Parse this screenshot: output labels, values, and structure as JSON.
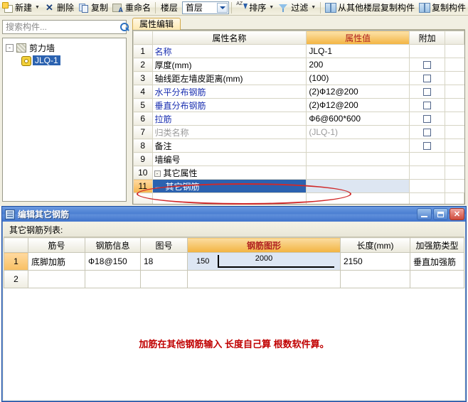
{
  "toolbar": {
    "items": [
      {
        "label": "新建",
        "icon": "new-icon",
        "caret": true
      },
      {
        "label": "删除",
        "icon": "delete-icon",
        "caret": false
      },
      {
        "label": "复制",
        "icon": "copy-icon",
        "caret": false
      },
      {
        "label": "重命名",
        "icon": "rename-icon",
        "caret": false
      }
    ],
    "floor_label": "楼层",
    "floor_value": "首层",
    "sort_label": "排序",
    "filter_label": "过滤",
    "copy_from_other_floor_label": "从其他楼层复制构件",
    "copy_component_label": "复制构件"
  },
  "sidebar": {
    "search": {
      "placeholder": "搜索构件...",
      "value": "",
      "icon": "search-icon"
    },
    "tree": {
      "root": {
        "label": "剪力墙",
        "icon": "shear-wall-icon",
        "expander": "-"
      },
      "child": {
        "label": "JLQ-1",
        "icon": "component-gear-icon",
        "selected": true
      }
    }
  },
  "property_panel": {
    "tab_label": "属性编辑",
    "headers": {
      "blank": "",
      "name": "属性名称",
      "value": "属性值",
      "additional": "附加"
    },
    "rows": [
      {
        "n": "1",
        "name": "名称",
        "value": "JLQ-1",
        "name_style": "blue",
        "value_style": "normal",
        "checkbox": false,
        "indent": 1
      },
      {
        "n": "2",
        "name": "厚度(mm)",
        "value": "200",
        "name_style": "black",
        "value_style": "normal",
        "checkbox": true,
        "indent": 1
      },
      {
        "n": "3",
        "name": "轴线距左墙皮距离(mm)",
        "value": "(100)",
        "name_style": "black",
        "value_style": "normal",
        "checkbox": true,
        "indent": 1
      },
      {
        "n": "4",
        "name": "水平分布钢筋",
        "value": "(2)Ф12@200",
        "name_style": "blue",
        "value_style": "normal",
        "checkbox": true,
        "indent": 1
      },
      {
        "n": "5",
        "name": "垂直分布钢筋",
        "value": "(2)Ф12@200",
        "name_style": "blue",
        "value_style": "normal",
        "checkbox": true,
        "indent": 1
      },
      {
        "n": "6",
        "name": "拉筋",
        "value": "Ф6@600*600",
        "name_style": "blue",
        "value_style": "normal",
        "checkbox": true,
        "indent": 1
      },
      {
        "n": "7",
        "name": "归类名称",
        "value": "(JLQ-1)",
        "name_style": "gray",
        "value_style": "gray",
        "checkbox": true,
        "indent": 1
      },
      {
        "n": "8",
        "name": "备注",
        "value": "",
        "name_style": "black",
        "value_style": "normal",
        "checkbox": true,
        "indent": 1
      },
      {
        "n": "9",
        "name": "墙编号",
        "value": "",
        "name_style": "black",
        "value_style": "normal",
        "checkbox": false,
        "indent": 1
      },
      {
        "n": "10",
        "name": "其它属性",
        "value": "",
        "name_style": "black",
        "value_style": "normal",
        "checkbox": false,
        "indent": 0,
        "group": true,
        "group_expander": "-"
      },
      {
        "n": "11",
        "name": "其它钢筋",
        "value": "",
        "name_style": "black",
        "value_style": "normal",
        "checkbox": false,
        "indent": 2,
        "selected": true
      }
    ]
  },
  "dialog": {
    "title": "编辑其它钢筋",
    "icon": "dialog-rebar-icon",
    "window_buttons": {
      "minimize": "minimize-icon",
      "maximize": "maximize-icon",
      "close": "✕"
    },
    "list_label": "其它钢筋列表:",
    "headers": [
      "",
      "筋号",
      "钢筋信息",
      "图号",
      "钢筋图形",
      "长度(mm)",
      "加强筋类型"
    ],
    "rows": [
      {
        "n": "1",
        "bar_name": "底脚加筋",
        "bar_info": "Ф18@150",
        "diagram_no": "18",
        "shape": {
          "left_label": "150",
          "mid_label": "2000"
        },
        "length": "2150",
        "reinforce_type": "垂直加强筋"
      },
      {
        "n": "2",
        "bar_name": "",
        "bar_info": "",
        "diagram_no": "",
        "shape": {
          "left_label": "",
          "mid_label": ""
        },
        "length": "",
        "reinforce_type": ""
      }
    ],
    "note": "加筋在其他钢筋输入 长度自己算 根数软件算。",
    "note_color": "#c00000"
  },
  "annotation": {
    "ellipse_color": "#d02a2a"
  }
}
